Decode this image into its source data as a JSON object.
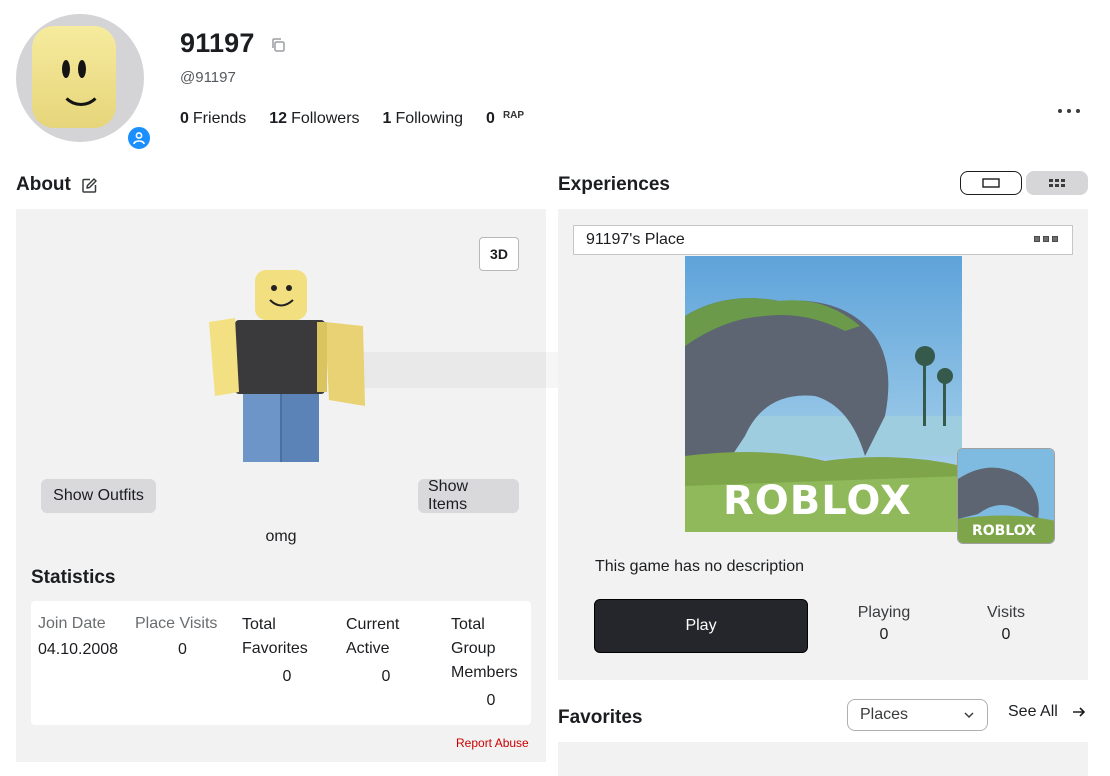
{
  "profile": {
    "display_name": "91197",
    "username": "@91197",
    "friends_count": "0",
    "friends_label": "Friends",
    "followers_count": "12",
    "followers_label": "Followers",
    "following_count": "1",
    "following_label": "Following",
    "rap_value": "0",
    "rap_label": "RAP"
  },
  "about": {
    "title": "About",
    "toggle_3d": "3D",
    "show_outfits": "Show Outfits",
    "show_items": "Show Items",
    "outfit_name": "omg"
  },
  "statistics": {
    "title": "Statistics",
    "join_date_label": "Join Date",
    "join_date_value": "04.10.2008",
    "place_visits_label": "Place Visits",
    "place_visits_value": "0",
    "total_favorites_label_1": "Total",
    "total_favorites_label_2": "Favorites",
    "total_favorites_value": "0",
    "current_active_label_1": "Current",
    "current_active_label_2": "Active",
    "current_active_value": "0",
    "group_members_label_1": "Total",
    "group_members_label_2": "Group",
    "group_members_label_3": "Members",
    "group_members_value": "0",
    "report_abuse": "Report Abuse"
  },
  "experiences": {
    "title": "Experiences",
    "place_name": "91197's Place",
    "thumbnail_logo": "ROBLOX",
    "no_description": "This game has no description",
    "play_label": "Play",
    "playing_label": "Playing",
    "playing_value": "0",
    "visits_label": "Visits",
    "visits_value": "0"
  },
  "favorites": {
    "title": "Favorites",
    "filter_selected": "Places",
    "see_all": "See All"
  },
  "colors": {
    "accent_blue": "#1c8fff",
    "play_button": "#24262b",
    "report_red": "#cc0000",
    "panel_bg": "#f2f2f2"
  },
  "icons": {
    "copy": "copy-icon",
    "edit": "edit-icon",
    "presence": "user-presence-icon",
    "more": "more-horizontal-icon",
    "list_view": "list-view-icon",
    "grid_view": "grid-view-icon",
    "chevron": "chevron-down-icon",
    "arrow": "arrow-right-icon"
  }
}
